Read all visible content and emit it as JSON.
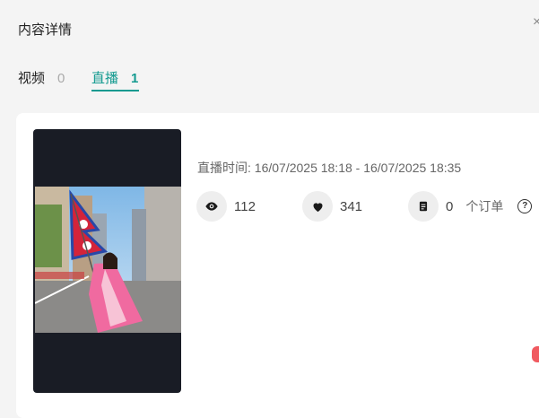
{
  "header": {
    "title": "内容详情",
    "close_icon": "close-icon"
  },
  "tabs": [
    {
      "label": "视频",
      "count": "0",
      "active": false
    },
    {
      "label": "直播",
      "count": "1",
      "active": true
    }
  ],
  "live": {
    "time_label": "直播时间:",
    "time_range": "16/07/2025 18:18 - 16/07/2025 18:35",
    "views": "112",
    "likes": "341",
    "orders": "0",
    "orders_label": "个订单",
    "help_glyph": "?"
  },
  "colors": {
    "accent": "#149a90",
    "media_bg": "#191c25",
    "badge": "#f05a60"
  }
}
